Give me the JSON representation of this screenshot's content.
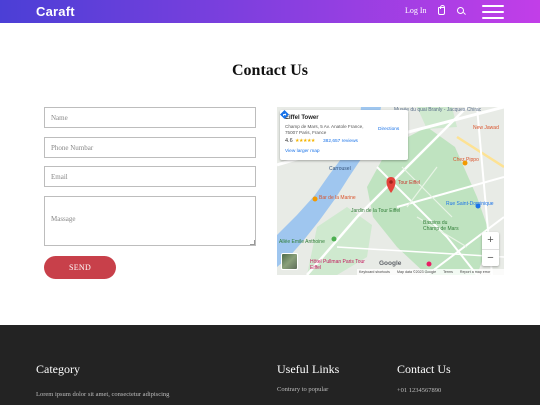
{
  "header": {
    "brand": "Caraft",
    "login_label": "Log In",
    "icons": [
      "bag-icon",
      "search-icon",
      "menu-icon"
    ]
  },
  "main": {
    "title": "Contact Us"
  },
  "form": {
    "name_placeholder": "Name",
    "phone_placeholder": "Phone Numbar",
    "email_placeholder": "Email",
    "message_placeholder": "Massage",
    "send_label": "SEND"
  },
  "map": {
    "place_name": "Eiffel Tower",
    "address": "Champ de Mars, 5 Av. Anatole France, 75007 Paris, France",
    "rating": "4.6",
    "stars": "★★★★★",
    "reviews": "382,657 reviews",
    "larger_map": "View larger map",
    "directions": "Directions",
    "labels": {
      "museum": "Musée du quai Branly - Jacques Chirac",
      "new_jawad": "New Jawad",
      "carrousel": "Carrousel",
      "tour_eiffel": "Tour Eiffel",
      "chez_pippo": "Chez Pippo",
      "bar_marine": "Bar de la Marine",
      "jardin": "Jardin de la Tour Eiffel",
      "rue_st_dominique": "Rue Saint-Dominique",
      "allee": "Allée Emile Anthoine",
      "bassins": "Bassins du Champ de Mars",
      "hotel": "Hôtel Pullman Paris Tour Eiffel"
    },
    "zoom_in": "+",
    "zoom_out": "−",
    "google": "Google",
    "attribution": {
      "shortcuts": "Keyboard shortcuts",
      "data": "Map data ©2023 Google",
      "terms": "Terms",
      "report": "Report a map error"
    },
    "colors": {
      "park": "#bfe3c0",
      "water": "#9fc6ef",
      "road": "#ffffff",
      "pin": "#e3433b"
    }
  },
  "footer": {
    "category_title": "Category",
    "category_text": "Lorem ipsum dolor sit amet, consectetur adipiscing",
    "links_title": "Useful Links",
    "link_1": "Contrary to popular",
    "contact_title": "Contact Us",
    "phone": "+01 1234567890"
  }
}
